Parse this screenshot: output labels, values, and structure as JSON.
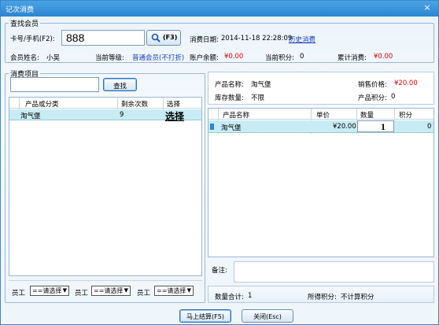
{
  "window": {
    "title": "记次消费",
    "close_icon": "×"
  },
  "member": {
    "group_label": "查找会员",
    "card_label": "卡号/手机(F2):",
    "card_value": "888",
    "search_button_label": "(F3)",
    "consume_date_label": "消费日期:",
    "consume_date_value": "2014-11-18 22:28:09",
    "history_link": "历史消费",
    "name_label": "会员姓名:",
    "name_value": "小吴",
    "level_label": "当前等级:",
    "level_value": "普通会员(不打折)",
    "balance_label": "账户余额:",
    "balance_value": "¥0.00",
    "points_label": "当前积分:",
    "points_value": "0",
    "total_label": "累计消费:",
    "total_value": "¥0.00"
  },
  "items": {
    "group_label": "消费项目",
    "search_value": "",
    "search_button": "查找",
    "columns": [
      "产品或分类",
      "剩余次数",
      "选择"
    ],
    "rows": [
      {
        "name": "淘气堡",
        "remaining": "9",
        "select": "选择"
      }
    ],
    "staff_label": "员工",
    "staff_select": "==请选择"
  },
  "product": {
    "name_label": "产品名称:",
    "name_value": "淘气堡",
    "price_label": "销售价格:",
    "price_value": "¥20.00",
    "stock_label": "库存数量:",
    "stock_value": "不限",
    "points_label": "产品积分:",
    "points_value": "0"
  },
  "cart": {
    "columns": [
      "产品名称",
      "单价",
      "数量",
      "积分"
    ],
    "rows": [
      {
        "name": "淘气堡",
        "price": "¥20.00",
        "qty": "1",
        "points": "0"
      }
    ],
    "remark_label": "备注:",
    "remark_value": "",
    "count_label": "数量合计:",
    "count_value": "1",
    "points_label": "所得积分:",
    "points_value": "不计算积分"
  },
  "footer": {
    "checkout_button": "马上结算(F5)",
    "close_button": "关闭(Esc)"
  },
  "colors": {
    "accent": "#2b86d0",
    "selected_row": "#c8ecf4",
    "money": "#e00000"
  }
}
